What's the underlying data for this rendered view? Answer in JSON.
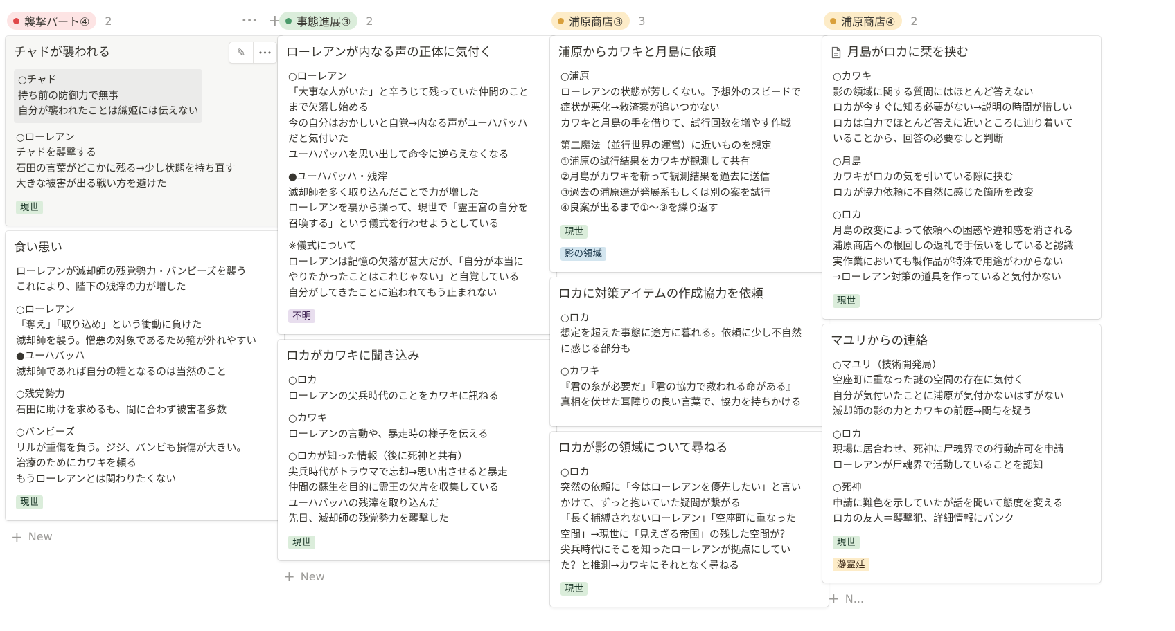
{
  "columns": [
    {
      "name": "襲撃パート④",
      "count": "2",
      "pill_bg": "#fde4e4",
      "dot": "#e0484a",
      "actions": {
        "more": "•••",
        "add": "+"
      },
      "new_label": "New",
      "cards": [
        {
          "title": "チャドが襲われる",
          "hovered": true,
          "tools": {
            "edit": "✎",
            "more": "•••"
          },
          "blocks": [
            {
              "text": "○チャド\n持ち前の防御力で無事\n自分が襲われたことは織姫には伝えない",
              "highlighted": true
            },
            {
              "text": "○ローレアン\nチャドを襲撃する\n石田の言葉がどこかに残る→少し状態を持ち直す\n大きな被害が出る戦い方を避けた"
            }
          ],
          "tags": [
            {
              "label": "現世",
              "bg": "#dbeddb",
              "fg": "#1c3829"
            }
          ]
        },
        {
          "title": "食い患い",
          "blocks": [
            {
              "text": "ローレアンが滅却師の残党勢力・バンビーズを襲う\nこれにより、陛下の残滓の力が増した"
            },
            {
              "text": "○ローレアン\n「奪え」「取り込め」という衝動に負けた\n滅却師を襲う。憎悪の対象であるため箍が外れやすい\n●ユーハバッハ\n滅却師であれば自分の糧となるのは当然のこと"
            },
            {
              "text": "○残党勢力\n石田に助けを求めるも、間に合わず被害者多数"
            },
            {
              "text": "○バンビーズ\nリルが重傷を負う。ジジ、バンビも損傷が大きい。\n治療のためにカワキを頼る\nもうローレアンとは関わりたくない"
            }
          ],
          "tags": [
            {
              "label": "現世",
              "bg": "#dbeddb",
              "fg": "#1c3829"
            }
          ]
        }
      ]
    },
    {
      "name": "事態進展③",
      "count": "2",
      "pill_bg": "#dbeddb",
      "dot": "#4b9a6a",
      "new_label": "New",
      "cards": [
        {
          "title": "ローレアンが内なる声の正体に気付く",
          "blocks": [
            {
              "text": "○ローレアン\n「大事な人がいた」と辛うじて残っていた仲間のこと\nまで欠落し始める\n今の自分はおかしいと自覚→内なる声がユーハバッハ\nだと気付いた\nユーハバッハを思い出して命令に逆らえなくなる"
            },
            {
              "text": "●ユーハバッハ・残滓\n滅却師を多く取り込んだことで力が増した\nローレアンを裏から操って、現世で「霊王宮の自分を\n召喚する」という儀式を行わせようとしている"
            },
            {
              "text": "※儀式について\nローレアンは記憶の欠落が甚大だが、「自分が本当に\nやりたかったことはこれじゃない」と自覚している\n自分がしてきたことに追われてもう止まれない"
            }
          ],
          "tags": [
            {
              "label": "不明",
              "bg": "#e8deee",
              "fg": "#412454"
            }
          ]
        },
        {
          "title": "ロカがカワキに聞き込み",
          "blocks": [
            {
              "text": "○ロカ\nローレアンの尖兵時代のことをカワキに訊ねる"
            },
            {
              "text": "○カワキ\nローレアンの言動や、暴走時の様子を伝える"
            },
            {
              "text": "○ロカが知った情報（後に死神と共有）\n尖兵時代がトラウマで忘却→思い出させると暴走\n仲間の蘇生を目的に霊王の欠片を収集している\nユーハバッハの残滓を取り込んだ\n先日、滅却師の残党勢力を襲撃した"
            }
          ],
          "tags": [
            {
              "label": "現世",
              "bg": "#dbeddb",
              "fg": "#1c3829"
            }
          ]
        }
      ]
    },
    {
      "name": "浦原商店③",
      "count": "3",
      "pill_bg": "#fdecc8",
      "dot": "#d9a03b",
      "cards": [
        {
          "title": "浦原からカワキと月島に依頼",
          "blocks": [
            {
              "text": "○浦原\nローレアンの状態が芳しくない。予想外のスピードで\n症状が悪化→救済案が追いつかない\nカワキと月島の手を借りて、試行回数を増やす作戦"
            },
            {
              "text": "第二魔法（並行世界の運営）に近いものを想定\n①浦原の試行結果をカワキが観測して共有\n②月島がカワキを斬って観測結果を過去に送信\n③過去の浦原達が発展系もしくは別の案を試行\n④良案が出るまで①〜③を繰り返す"
            }
          ],
          "tags": [
            {
              "label": "現世",
              "bg": "#dbeddb",
              "fg": "#1c3829"
            },
            {
              "label": "影の領域",
              "bg": "#d3e5ef",
              "fg": "#183347"
            }
          ]
        },
        {
          "title": "ロカに対策アイテムの作成協力を依頼",
          "blocks": [
            {
              "text": "○ロカ\n想定を超えた事態に途方に暮れる。依頼に少し不自然\nに感じる部分も"
            },
            {
              "text": "○カワキ\n『君の糸が必要だ』『君の協力で救われる命がある』\n真相を伏せた耳障りの良い言葉で、協力を持ちかける"
            }
          ],
          "tags": []
        },
        {
          "title": "ロカが影の領域について尋ねる",
          "blocks": [
            {
              "text": "○ロカ\n突然の依頼に「今はローレアンを優先したい」と言い\nかけて、ずっと抱いていた疑問が繋がる\n「長く捕縛されないローレアン」「空座町に重なった\n空間」→現世に「見えざる帝国」の残した空間が？\n尖兵時代にそこを知ったローレアンが拠点にしてい\nた？と推測→カワキにそれとなく尋ねる"
            }
          ],
          "tags": [
            {
              "label": "現世",
              "bg": "#dbeddb",
              "fg": "#1c3829"
            }
          ]
        }
      ]
    },
    {
      "name": "浦原商店④",
      "count": "2",
      "pill_bg": "#fdecc8",
      "dot": "#d9a03b",
      "new_label": "N...",
      "cards": [
        {
          "title": "月島がロカに栞を挟む",
          "has_doc_icon": true,
          "blocks": [
            {
              "text": "○カワキ\n影の領域に関する質問にはほとんど答えない\nロカが今すぐに知る必要がない→説明の時間が惜しい\nロカは自力でほとんど答えに近いところに辿り着いて\nいることから、回答の必要なしと判断"
            },
            {
              "text": "○月島\nカワキがロカの気を引いている隙に挟む\nロカが協力依頼に不自然に感じた箇所を改変"
            },
            {
              "text": "○ロカ\n月島の改変によって依頼への困惑や違和感を消される\n浦原商店への根回しの返礼で手伝いをしていると認識\n実作業においても製作品が特殊で用途がわからない\n→ローレアン対策の道具を作っていると気付かない"
            }
          ],
          "tags": [
            {
              "label": "現世",
              "bg": "#dbeddb",
              "fg": "#1c3829"
            }
          ]
        },
        {
          "title": "マユリからの連絡",
          "blocks": [
            {
              "text": "○マユリ（技術開発局）\n空座町に重なった謎の空間の存在に気付く\n自分が気付いたことに浦原が気付かないはずがない\n滅却師の影の力とカワキの前歴→関与を疑う"
            },
            {
              "text": "○ロカ\n現場に居合わせ、死神に尸魂界での行動許可を申請\nローレアンが尸魂界で活動していることを認知"
            },
            {
              "text": "○死神\n申請に難色を示していたが話を聞いて態度を変える\nロカの友人＝襲撃犯、詳細情報にパンク"
            }
          ],
          "tags": [
            {
              "label": "現世",
              "bg": "#dbeddb",
              "fg": "#1c3829"
            },
            {
              "label": "瀞霊廷",
              "bg": "#fdecc8",
              "fg": "#402c1b"
            }
          ]
        }
      ]
    }
  ]
}
